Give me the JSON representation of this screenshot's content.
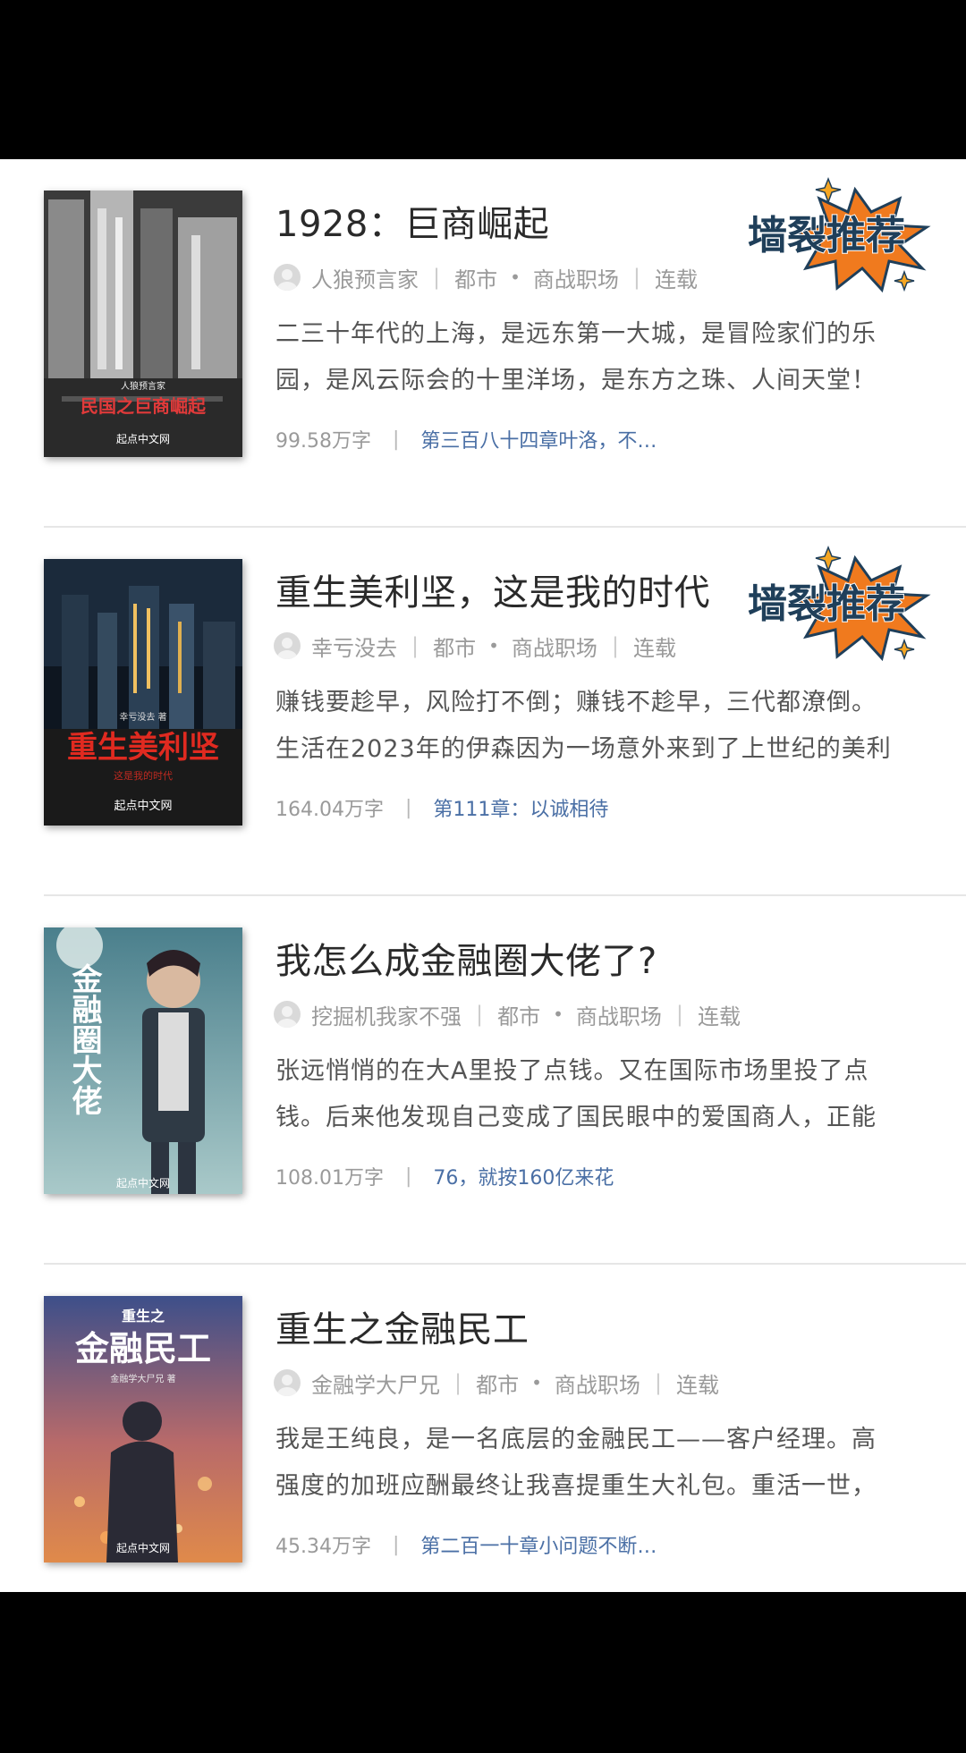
{
  "books": [
    {
      "title": "1928：巨商崛起",
      "author": "人狼预言家",
      "category": "都市",
      "subcategory": "商战职场",
      "status": "连载",
      "intro_line1": "二三十年代的上海，是远东第一大城，是冒险家们的乐",
      "intro_line2": "园，是风云际会的十里洋场，是东方之珠、人间天堂！",
      "word_count": "99.58万字",
      "latest_chapter": "第三百八十四章叶洛，不…",
      "badge": "墙裂推荐",
      "cover_title": "民国之巨商崛起",
      "cover_small": "人狼预言家",
      "cover_publisher": "起点中文网"
    },
    {
      "title": "重生美利坚，这是我的时代",
      "author": "幸亏没去",
      "category": "都市",
      "subcategory": "商战职场",
      "status": "连载",
      "intro_line1": "赚钱要趁早，风险打不倒；赚钱不趁早，三代都潦倒。",
      "intro_line2": "生活在2023年的伊森因为一场意外来到了上世纪的美利",
      "word_count": "164.04万字",
      "latest_chapter": "第111章：以诚相待",
      "badge": "墙裂推荐",
      "cover_title": "重生美利坚",
      "cover_subtitle": "这是我的时代",
      "cover_small": "幸亏没去 著",
      "cover_publisher": "起点中文网"
    },
    {
      "title": "我怎么成金融圈大佬了?",
      "author": "挖掘机我家不强",
      "category": "都市",
      "subcategory": "商战职场",
      "status": "连载",
      "intro_line1": "张远悄悄的在大A里投了点钱。又在国际市场里投了点",
      "intro_line2": "钱。后来他发现自己变成了国民眼中的爱国商人，正能",
      "word_count": "108.01万字",
      "latest_chapter": "76，就按160亿来花",
      "cover_title": "金融圈大佬",
      "cover_publisher": "起点中文网"
    },
    {
      "title": "重生之金融民工",
      "author": "金融学大尸兄",
      "category": "都市",
      "subcategory": "商战职场",
      "status": "连载",
      "intro_line1": "我是王纯良，是一名底层的金融民工——客户经理。高",
      "intro_line2": "强度的加班应酬最终让我喜提重生大礼包。重活一世，",
      "word_count": "45.34万字",
      "latest_chapter": "第二百一十章小问题不断…",
      "cover_small_top": "重生之",
      "cover_title": "金融民工",
      "cover_author": "金融学大尸兄 著",
      "cover_publisher": "起点中文网"
    }
  ],
  "colors": {
    "badge_fill": "#f07a1e",
    "badge_text": "#1f3f5a",
    "chapter_link": "#4a6fa5",
    "title": "#2a2a2a"
  }
}
